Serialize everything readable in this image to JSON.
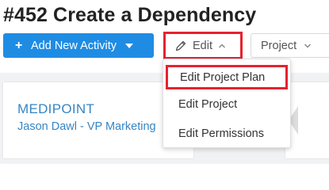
{
  "page": {
    "title": "#452 Create a Dependency"
  },
  "toolbar": {
    "add_activity_label": "Add New Activity",
    "edit_label": "Edit",
    "project_label": "Project"
  },
  "edit_menu": {
    "items": [
      {
        "label": "Edit Project Plan",
        "highlighted": true
      },
      {
        "label": "Edit Project"
      },
      {
        "label": "Edit Permissions"
      }
    ]
  },
  "card": {
    "company": "MEDIPOINT",
    "contact": "Jason Dawl - VP Marketing"
  },
  "colors": {
    "primary_button": "#1f8ce4",
    "highlight_border": "#e5222f",
    "link": "#3585c4"
  },
  "icons": {
    "add": "plus-icon",
    "edit": "pencil-icon",
    "edit_toggle": "chevron-up-icon",
    "project_toggle": "chevron-down-icon",
    "add_toggle": "caret-down-icon"
  }
}
